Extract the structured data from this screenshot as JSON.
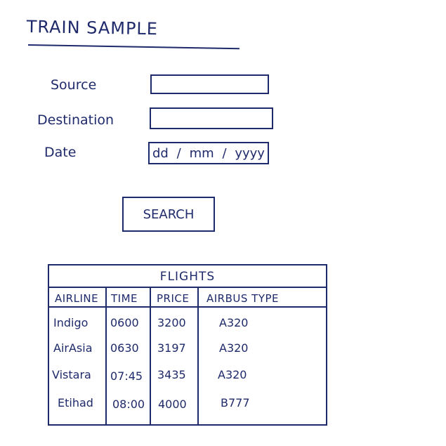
{
  "header": {
    "title": "TRAIN SAMPLE"
  },
  "form": {
    "source_label": "Source",
    "destination_label": "Destination",
    "date_label": "Date",
    "date_placeholder": {
      "dd": "dd",
      "mm": "mm",
      "yyyy": "yyyy"
    },
    "search_label": "SEARCH"
  },
  "flights": {
    "title": "FLIGHTS",
    "columns": [
      "AIRLINE",
      "TIME",
      "PRICE",
      "AIRBUS TYPE"
    ],
    "rows": [
      {
        "airline": "Indigo",
        "time": "0600",
        "price": "3200",
        "type": "A320"
      },
      {
        "airline": "AirAsia",
        "time": "0630",
        "price": "3197",
        "type": "A320"
      },
      {
        "airline": "Vistara",
        "time": "07:45",
        "price": "3435",
        "type": "A320"
      },
      {
        "airline": "Etihad",
        "time": "08:00",
        "price": "4000",
        "type": "B777"
      }
    ]
  },
  "colors": {
    "ink": "#1f2a6b",
    "paper": "#ffffff"
  }
}
